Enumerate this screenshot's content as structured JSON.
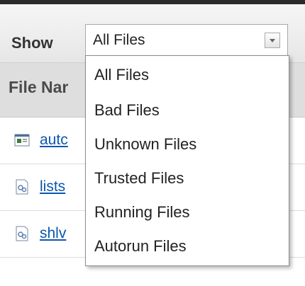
{
  "toolbar": {
    "show_label": "Show",
    "select_value": "All Files"
  },
  "table": {
    "header": "File Nar",
    "rows": [
      {
        "icon": "application-icon",
        "name": "autc"
      },
      {
        "icon": "dll-file-icon",
        "name": "lists"
      },
      {
        "icon": "dll-file-icon",
        "name": "shlv"
      }
    ]
  },
  "dropdown": {
    "options": [
      "All Files",
      "Bad Files",
      "Unknown Files",
      "Trusted Files",
      "Running Files",
      "Autorun Files"
    ]
  },
  "colors": {
    "link": "#0a56b0",
    "header_bg": "#dedede"
  }
}
